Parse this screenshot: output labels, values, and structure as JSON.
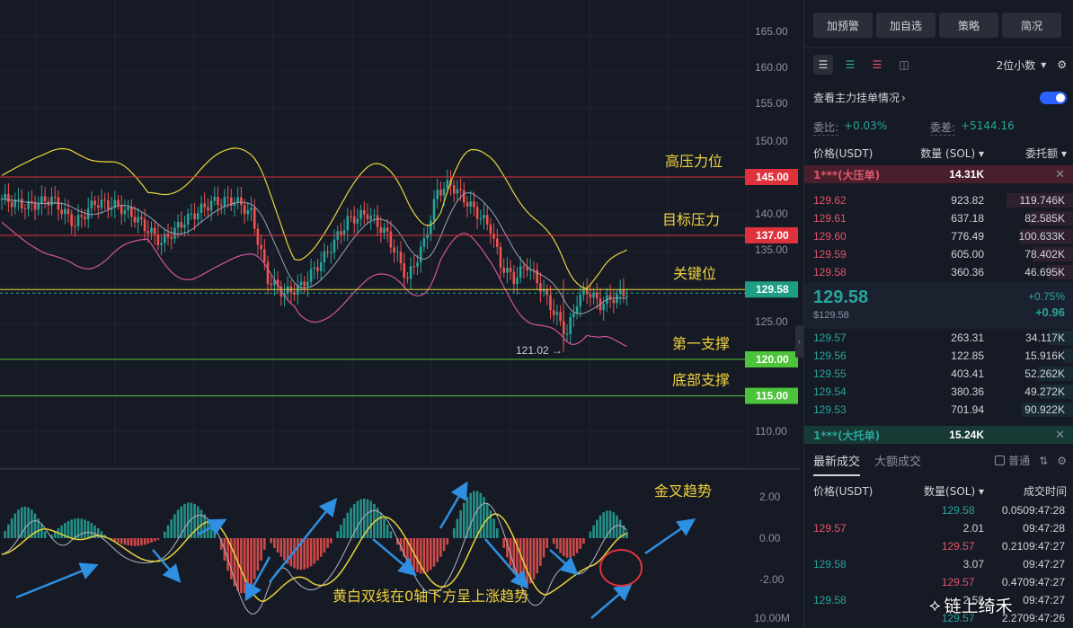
{
  "chart": {
    "price_axis": [
      "165.00",
      "160.00",
      "155.00",
      "150.00",
      "140.00",
      "135.00",
      "125.00",
      "110.00"
    ],
    "macd_axis": [
      "2.00",
      "0.00",
      "-2.00",
      "10.00M"
    ],
    "levels": [
      {
        "price": "145.00",
        "label": "高压力位",
        "color": "#e0323c",
        "tag_color": "#e0323c"
      },
      {
        "price": "137.00",
        "label": "目标压力",
        "color": "#e0323c",
        "tag_color": "#e0323c"
      },
      {
        "price": "129.58",
        "label": "关键位",
        "color": "#e8d43a",
        "tag_color": "#1e9e86"
      },
      {
        "price": "120.00",
        "label": "第一支撑",
        "color": "#4cc33a",
        "tag_color": "#4cc33a"
      },
      {
        "price": "115.00",
        "label": "底部支撑",
        "color": "#4cc33a",
        "tag_color": "#4cc33a"
      }
    ],
    "low_marker": "121.02 →",
    "macd_label": "金叉趋势",
    "macd_note": "黄白双线在0轴下方呈上涨趋势"
  },
  "panel": {
    "buttons": [
      "加预警",
      "加自选",
      "策略",
      "简况"
    ],
    "decimals": "2位小数",
    "view_main_orders": "查看主力挂单情况",
    "ratio_label": "委比:",
    "ratio_value": "+0.03%",
    "diff_label": "委差:",
    "diff_value": "+5144.16",
    "orderbook_headers": [
      "价格(USDT)",
      "数量 (SOL)",
      "委托额"
    ],
    "big_ask": {
      "label": "1***(大压单)",
      "qty": "14.31K"
    },
    "asks": [
      {
        "price": "129.62",
        "qty": "923.82",
        "total": "119.746K"
      },
      {
        "price": "129.61",
        "qty": "637.18",
        "total": "82.585K"
      },
      {
        "price": "129.60",
        "qty": "776.49",
        "total": "100.633K"
      },
      {
        "price": "129.59",
        "qty": "605.00",
        "total": "78.402K"
      },
      {
        "price": "129.58",
        "qty": "360.36",
        "total": "46.695K"
      }
    ],
    "mid": {
      "price": "129.58",
      "usd": "$129.58",
      "pct": "+0.75%",
      "chg": "+0.96"
    },
    "bids": [
      {
        "price": "129.57",
        "qty": "263.31",
        "total": "34.117K"
      },
      {
        "price": "129.56",
        "qty": "122.85",
        "total": "15.916K"
      },
      {
        "price": "129.55",
        "qty": "403.41",
        "total": "52.262K"
      },
      {
        "price": "129.54",
        "qty": "380.36",
        "total": "49.272K"
      },
      {
        "price": "129.53",
        "qty": "701.94",
        "total": "90.922K"
      }
    ],
    "big_bid": {
      "label": "1***(大托单)",
      "qty": "15.24K"
    },
    "trade_tabs": [
      "最新成交",
      "大额成交"
    ],
    "trade_filter": "普通",
    "trade_headers": [
      "价格(USDT)",
      "数量(SOL)",
      "成交时间"
    ],
    "trades": [
      {
        "price": "129.58",
        "qty": "0.05",
        "time": "09:47:28",
        "side": "buy"
      },
      {
        "price": "129.57",
        "qty": "2.01",
        "time": "09:47:28",
        "side": "sell"
      },
      {
        "price": "129.57",
        "qty": "0.21",
        "time": "09:47:27",
        "side": "sell"
      },
      {
        "price": "129.58",
        "qty": "3.07",
        "time": "09:47:27",
        "side": "buy"
      },
      {
        "price": "129.57",
        "qty": "0.47",
        "time": "09:47:27",
        "side": "sell"
      },
      {
        "price": "129.58",
        "qty": "2.58",
        "time": "09:47:27",
        "side": "buy"
      },
      {
        "price": "129.57",
        "qty": "2.27",
        "time": "09:47:26",
        "side": "buy"
      }
    ]
  },
  "watermark": "链上绮禾"
}
